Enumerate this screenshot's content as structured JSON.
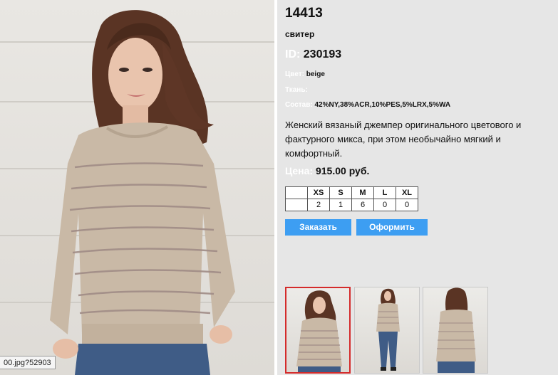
{
  "product": {
    "title": "14413",
    "type": "свитер",
    "id_label": "ID:",
    "id_value": "230193",
    "color_label": "Цвет:",
    "color_value": "beige",
    "fabric_label": "Ткань:",
    "fabric_value": "",
    "composition_label": "Состав:",
    "composition_value": "42%NY,38%ACR,10%PES,5%LRX,5%WA",
    "description": "Женский вязаный джемпер оригинального цветового и фактурного микса, при этом необычайно мягкий и комфортный.",
    "price_label": "Цена:",
    "price_value": "915.00 руб."
  },
  "sizes": {
    "headers": [
      "XS",
      "S",
      "M",
      "L",
      "XL"
    ],
    "quantities": [
      "2",
      "1",
      "6",
      "0",
      "0"
    ]
  },
  "buttons": {
    "order": "Заказать",
    "checkout": "Оформить"
  },
  "status_tip": "00.jpg?52903",
  "colors": {
    "accent": "#3d9ef2",
    "panel": "#e6e6e6",
    "active_thumb_border": "#d42b2b"
  }
}
